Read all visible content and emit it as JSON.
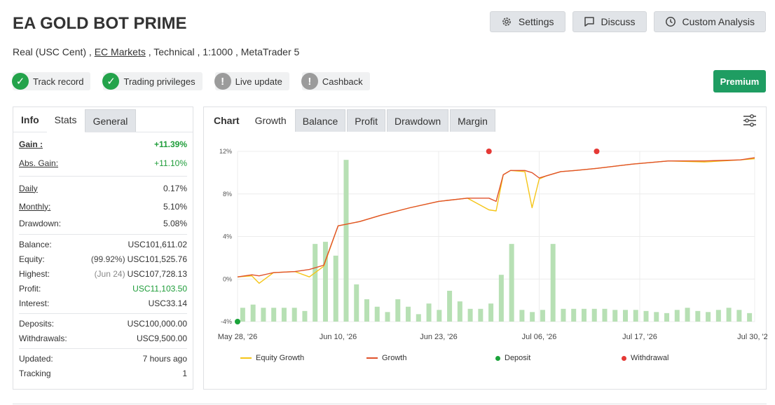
{
  "header": {
    "title": "EA GOLD BOT PRIME",
    "buttons": {
      "settings": "Settings",
      "discuss": "Discuss",
      "custom": "Custom Analysis"
    },
    "subtitle": {
      "account": "Real (USC Cent) ,",
      "broker": "EC Markets",
      "rest": ", Technical , 1:1000 , MetaTrader 5"
    }
  },
  "badges": [
    {
      "label": "Track record",
      "status": "ok"
    },
    {
      "label": "Trading privileges",
      "status": "ok"
    },
    {
      "label": "Live update",
      "status": "warn"
    },
    {
      "label": "Cashback",
      "status": "warn"
    }
  ],
  "premium_label": "Premium",
  "left_tabs": [
    "Info",
    "Stats",
    "General"
  ],
  "stats": {
    "gain": {
      "label": "Gain :",
      "value": "+11.39%"
    },
    "abs_gain": {
      "label": "Abs. Gain:",
      "value": "+11.10%"
    },
    "daily": {
      "label": "Daily",
      "value": "0.17%"
    },
    "monthly": {
      "label": "Monthly:",
      "value": "5.10%"
    },
    "drawdown": {
      "label": "Drawdown:",
      "value": "5.08%"
    },
    "balance": {
      "label": "Balance:",
      "value": "USC101,611.02"
    },
    "equity": {
      "label": "Equity:",
      "note": "(99.92%)",
      "value": "USC101,525.76"
    },
    "highest": {
      "label": "Highest:",
      "note": "(Jun 24)",
      "value": "USC107,728.13"
    },
    "profit": {
      "label": "Profit:",
      "value": "USC11,103.50"
    },
    "interest": {
      "label": "Interest:",
      "value": "USC33.14"
    },
    "deposits": {
      "label": "Deposits:",
      "value": "USC100,000.00"
    },
    "withdrawals": {
      "label": "Withdrawals:",
      "value": "USC9,500.00"
    },
    "updated": {
      "label": "Updated:",
      "value": "7 hours ago"
    },
    "tracking": {
      "label": "Tracking",
      "value": "1"
    }
  },
  "chart_tabs": [
    "Chart",
    "Growth",
    "Balance",
    "Profit",
    "Drawdown",
    "Margin"
  ],
  "colors": {
    "equity": "#f5c518",
    "growth": "#e0522b",
    "deposit": "#1aa33a",
    "withdrawal": "#e53935",
    "bars": "#b7e0b4",
    "accent": "#1f9d62"
  },
  "chart_data": {
    "type": "line",
    "ylim": [
      -4,
      12
    ],
    "y_ticks": [
      "12%",
      "8%",
      "4%",
      "0%",
      "-4%"
    ],
    "x_ticks": [
      "May 28, '26",
      "Jun 10, '26",
      "Jun 23, '26",
      "Jul 06, '26",
      "Jul 17, '26",
      "Jul 30, '26"
    ],
    "series": [
      {
        "name": "Equity Growth",
        "x": [
          0,
          2,
          3,
          5,
          8,
          10,
          12,
          14,
          17,
          20,
          24,
          28,
          32,
          35,
          36,
          37,
          38,
          40,
          41,
          42,
          43,
          44,
          45,
          47,
          50,
          55,
          60,
          65,
          70,
          72
        ],
        "y": [
          0.2,
          0.3,
          -0.4,
          0.6,
          0.7,
          0.2,
          1.2,
          5.0,
          5.4,
          6.0,
          6.7,
          7.3,
          7.6,
          6.5,
          6.4,
          9.8,
          10.2,
          10.1,
          6.7,
          9.4,
          9.7,
          9.9,
          10.1,
          10.2,
          10.4,
          10.8,
          11.1,
          11.0,
          11.2,
          11.3
        ]
      },
      {
        "name": "Growth",
        "x": [
          0,
          2,
          3,
          5,
          8,
          10,
          12,
          14,
          17,
          20,
          24,
          28,
          32,
          35,
          36,
          37,
          38,
          40,
          41,
          42,
          43,
          44,
          45,
          47,
          50,
          55,
          60,
          65,
          70,
          72
        ],
        "y": [
          0.2,
          0.4,
          0.3,
          0.6,
          0.7,
          0.9,
          1.3,
          5.0,
          5.4,
          6.0,
          6.7,
          7.3,
          7.6,
          7.6,
          7.3,
          9.8,
          10.2,
          10.2,
          10.0,
          9.5,
          9.7,
          9.9,
          10.1,
          10.2,
          10.4,
          10.8,
          11.1,
          11.1,
          11.2,
          11.4
        ]
      }
    ],
    "bars": {
      "name": "Profit",
      "values": [
        -2.7,
        -2.4,
        -2.7,
        -2.7,
        -2.7,
        -2.7,
        -3.0,
        3.3,
        3.5,
        2.2,
        11.2,
        -0.5,
        -1.9,
        -2.6,
        -3.1,
        -1.9,
        -2.6,
        -3.3,
        -2.3,
        -2.9,
        -1.1,
        -2.1,
        -2.8,
        -2.8,
        -2.3,
        0.4,
        3.3,
        -2.9,
        -3.1,
        -2.9,
        3.3,
        -2.8,
        -2.8,
        -2.8,
        -2.8,
        -2.8,
        -2.9,
        -2.9,
        -2.9,
        -3.0,
        -3.1,
        -3.2,
        -2.9,
        -2.7,
        -3.0,
        -3.1,
        -2.9,
        -2.7,
        -2.9,
        -3.2
      ]
    },
    "deposits": [
      {
        "x": 0,
        "y": -4
      }
    ],
    "withdrawals": [
      {
        "x": 35,
        "y": 12
      },
      {
        "x": 50,
        "y": 12
      }
    ],
    "legend": [
      "Equity Growth",
      "Growth",
      "Deposit",
      "Withdrawal"
    ]
  }
}
